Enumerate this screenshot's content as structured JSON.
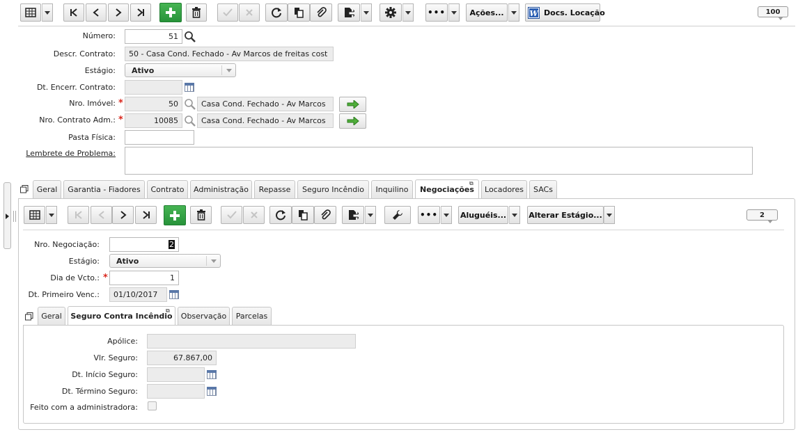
{
  "toolbar": {
    "acoes_label": "Ações...",
    "docs_label": "Docs. Locação",
    "record_count": "100"
  },
  "form": {
    "numero_label": "Número:",
    "numero_value": "51",
    "descr_label": "Descr. Contrato:",
    "descr_value": "50 - Casa Cond. Fechado - Av Marcos de freitas cost",
    "estagio_label": "Estágio:",
    "estagio_value": "Ativo",
    "dt_encerr_label": "Dt. Encerr. Contrato:",
    "dt_encerr_value": "",
    "nro_imovel_label": "Nro. Imóvel:",
    "nro_imovel_value": "50",
    "nro_imovel_desc": "Casa Cond. Fechado - Av Marcos",
    "nro_contrato_label": "Nro. Contrato Adm.:",
    "nro_contrato_value": "10085",
    "nro_contrato_desc": "Casa Cond. Fechado - Av Marcos",
    "pasta_label": "Pasta Física:",
    "pasta_value": "",
    "lembrete_label": "Lembrete de Problema:",
    "lembrete_value": ""
  },
  "main_tabs": [
    "Geral",
    "Garantia - Fiadores",
    "Contrato",
    "Administração",
    "Repasse",
    "Seguro Incêndio",
    "Inquilino",
    "Negociações",
    "Locadores",
    "SACs"
  ],
  "sub_toolbar": {
    "alugueis_label": "Aluguéis...",
    "alterar_label": "Alterar Estágio...",
    "record_count": "2"
  },
  "negociacao": {
    "nro_label": "Nro. Negociação:",
    "nro_value": "2",
    "estagio_label": "Estágio:",
    "estagio_value": "Ativo",
    "dia_label": "Dia de Vcto.:",
    "dia_value": "1",
    "dt_primeiro_label": "Dt. Primeiro Venc.:",
    "dt_primeiro_value": "01/10/2017"
  },
  "sub_tabs": [
    "Geral",
    "Seguro Contra Incêndio",
    "Observação",
    "Parcelas"
  ],
  "seguro": {
    "apolice_label": "Apólice:",
    "apolice_value": "",
    "vlr_label": "Vlr. Seguro:",
    "vlr_value": "67.867,00",
    "dt_inicio_label": "Dt. Início Seguro:",
    "dt_inicio_value": "",
    "dt_termino_label": "Dt. Término Seguro:",
    "dt_termino_value": "",
    "feito_label": "Feito com a administradora:"
  }
}
